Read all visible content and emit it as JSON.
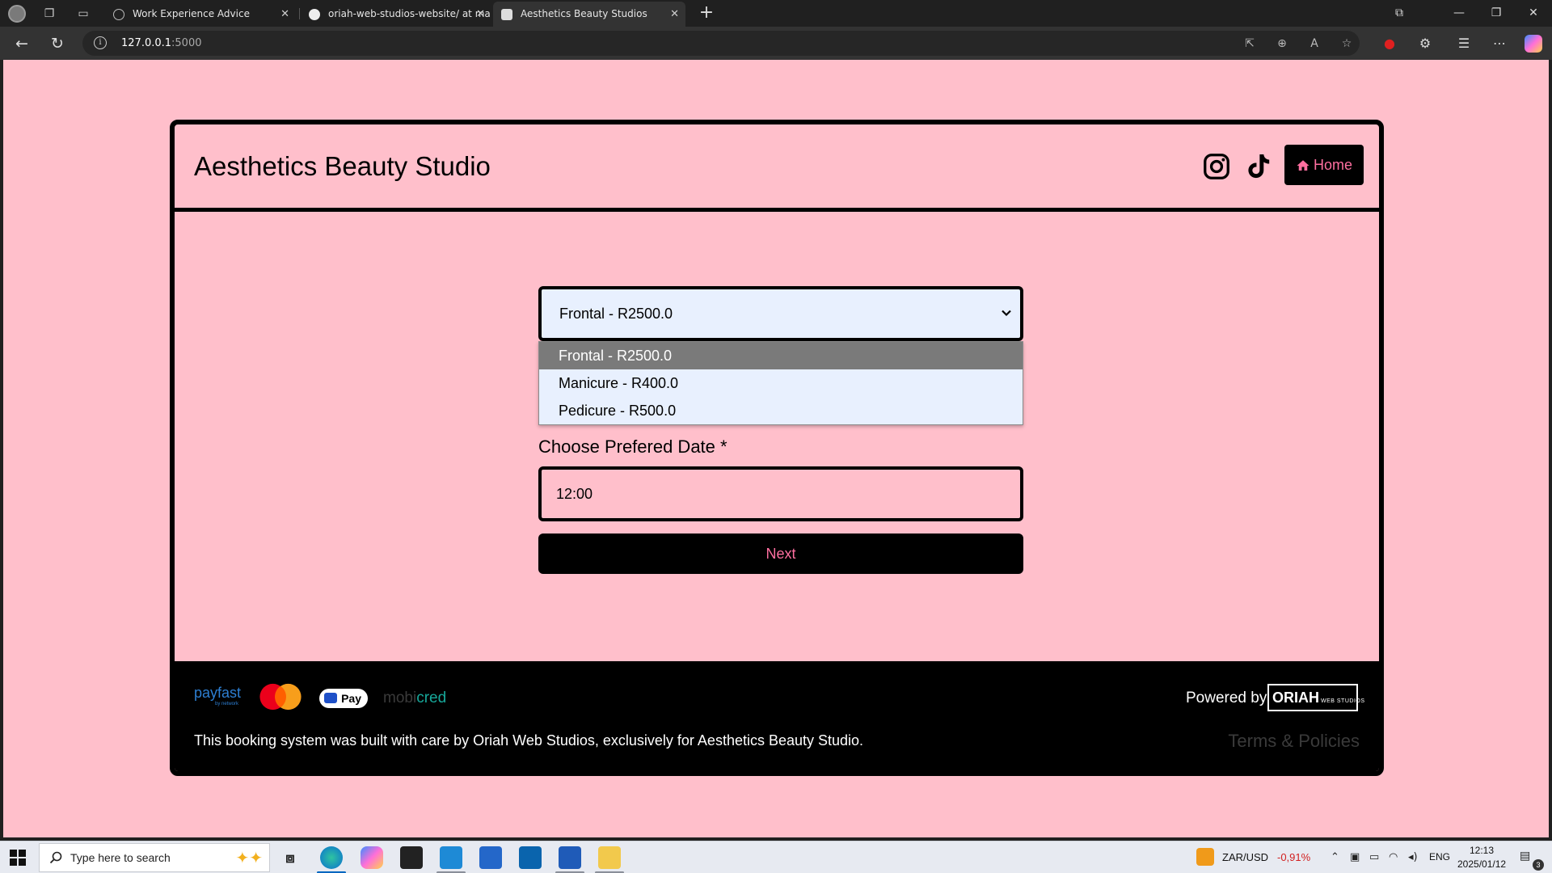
{
  "browser": {
    "tabs": [
      {
        "label": "Work Experience Advice",
        "active": false
      },
      {
        "label": "oriah-web-studios-website/ at ma",
        "active": false
      },
      {
        "label": "Aesthetics Beauty Studios",
        "active": true
      }
    ],
    "url_host": "127.0.0.1",
    "url_port": ":5000"
  },
  "site": {
    "brand": "Aesthetics Beauty Studio",
    "home_label": "Home",
    "accent_color": "#ff6fa0",
    "background_color": "#ffbfcb"
  },
  "form": {
    "service_selected": "Frontal - R2500.0",
    "service_options": [
      "Frontal - R2500.0",
      "Manicure - R400.0",
      "Pedicure - R500.0"
    ],
    "date_label": "Choose Prefered Date *",
    "time_value": "12:00",
    "next_label": "Next"
  },
  "footer": {
    "payfast": "payfast",
    "payfast_sub": "by network",
    "pay_label": "Pay",
    "mobicred_a": "mobi",
    "mobicred_b": "cred",
    "powered_by": "Powered by",
    "oriah_logo": "ORIAH",
    "oriah_logo_sub": "WEB STUDIOS",
    "credit": "This booking system was built with care by Oriah Web Studios, exclusively for Aesthetics Beauty Studio.",
    "terms": "Terms & Policies"
  },
  "taskbar": {
    "search_placeholder": "Type here to search",
    "currency_pair": "ZAR/USD",
    "currency_change": "-0,91%",
    "language": "ENG",
    "time": "12:13",
    "date": "2025/01/12",
    "notifications": "3"
  }
}
